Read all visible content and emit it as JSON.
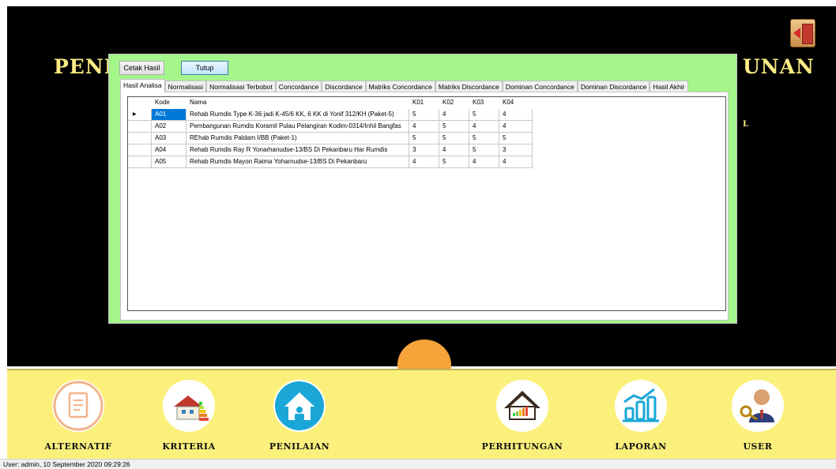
{
  "window": {
    "title_left": "PENE",
    "title_right": "UNAN",
    "subtitle_fragment": "L"
  },
  "dialog": {
    "buttons": {
      "cetak": "Cetak Hasil",
      "tutup": "Tutup"
    },
    "tabs": [
      "Hasil Analisa",
      "Normalisasi",
      "Normalisasi Terbobot",
      "Concordance",
      "Discordance",
      "Matriks Concordance",
      "Matriks Discordance",
      "Dominan Concordance",
      "Dominan Discordance",
      "Hasil Akhir"
    ],
    "active_tab": "Hasil Analisa",
    "grid": {
      "columns": [
        "Kode",
        "Nama",
        "K01",
        "K02",
        "K03",
        "K04"
      ],
      "rows": [
        [
          "A01",
          "Rehab Rumdis Type K-36 jadi K-45/6 KK, 6 KK di Yonif 312/KH (Paket-5)",
          "5",
          "4",
          "5",
          "4"
        ],
        [
          "A02",
          "Pembangunan Rumdis Koramil Pulau Pelangiran Kodim-0314/Inhil Bangfas",
          "4",
          "5",
          "4",
          "4"
        ],
        [
          "A03",
          "REhab Rumdis Paldam I/BB (Paket-1)",
          "5",
          "5",
          "5",
          "5"
        ],
        [
          "A04",
          "Rehab Rumdis Ray R Yonarhanudse-13/BS Di Pekanbaru Har Rumdis",
          "3",
          "4",
          "5",
          "3"
        ],
        [
          "A05",
          "Rehab Rumdis Mayon Raima Yoharnudse-13/BS Di Pekanbaru",
          "4",
          "5",
          "4",
          "4"
        ]
      ],
      "selected_row": 0
    }
  },
  "nav": [
    {
      "label": "ALTERNATIF",
      "icon": "receipt-icon"
    },
    {
      "label": "KRITERIA",
      "icon": "house-energy-icon"
    },
    {
      "label": "PENILAIAN",
      "icon": "house-user-icon"
    },
    {
      "label": "PERHITUNGAN",
      "icon": "house-rating-icon"
    },
    {
      "label": "LAPORAN",
      "icon": "bar-chart-icon"
    },
    {
      "label": "USER",
      "icon": "user-keys-icon"
    }
  ],
  "status": {
    "text": "User: admin, 10 September 2020 09:29:26"
  },
  "colors": {
    "background": "#000000",
    "dialog": "#a4f58a",
    "title": "#fcec84",
    "navbar": "#fcf07c",
    "accent": "#f6a33a",
    "selection": "#0078d7"
  }
}
